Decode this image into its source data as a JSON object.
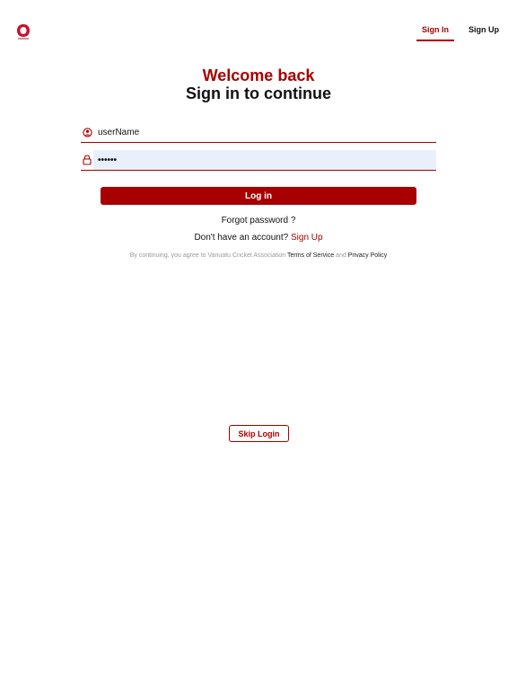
{
  "nav": {
    "sign_in_label": "Sign In",
    "sign_up_label": "Sign Up"
  },
  "heading": {
    "welcome": "Welcome back",
    "subtitle": "Sign in to continue"
  },
  "form": {
    "username_value": "userName",
    "username_icon": "user-circle-icon",
    "password_value": "••••••",
    "password_icon": "lock-icon",
    "login_label": "Log in"
  },
  "links": {
    "forgot_password": "Forgot password ?",
    "no_account_text": "Don't have an account?",
    "sign_up_link": "Sign Up"
  },
  "terms": {
    "prefix": "By continuing, you agree to Vanuatu Cricket Association",
    "terms_link": "Terms of Service",
    "and": "and",
    "privacy_link": "Privacy Policy"
  },
  "skip_label": "Skip Login",
  "colors": {
    "accent": "#a80000",
    "password_field_bg": "#e8f0fe"
  }
}
